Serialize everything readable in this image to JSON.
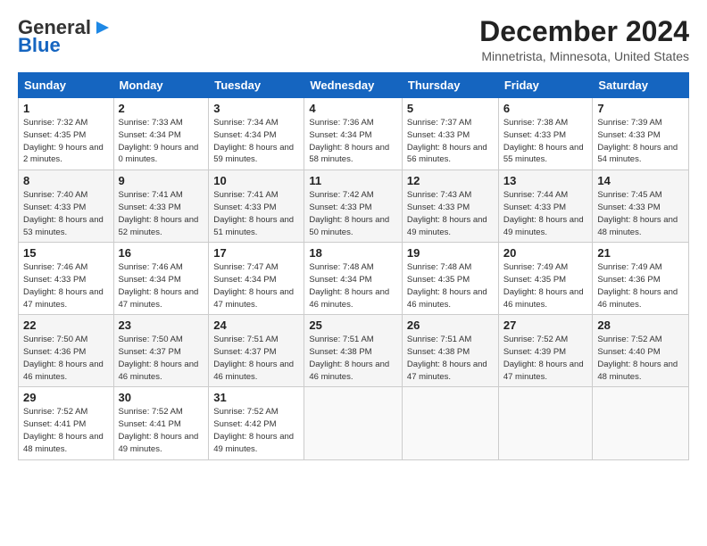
{
  "header": {
    "logo_line1": "General",
    "logo_line2": "Blue",
    "title": "December 2024",
    "subtitle": "Minnetrista, Minnesota, United States"
  },
  "days_of_week": [
    "Sunday",
    "Monday",
    "Tuesday",
    "Wednesday",
    "Thursday",
    "Friday",
    "Saturday"
  ],
  "weeks": [
    [
      {
        "day": "1",
        "sunrise": "Sunrise: 7:32 AM",
        "sunset": "Sunset: 4:35 PM",
        "daylight": "Daylight: 9 hours and 2 minutes."
      },
      {
        "day": "2",
        "sunrise": "Sunrise: 7:33 AM",
        "sunset": "Sunset: 4:34 PM",
        "daylight": "Daylight: 9 hours and 0 minutes."
      },
      {
        "day": "3",
        "sunrise": "Sunrise: 7:34 AM",
        "sunset": "Sunset: 4:34 PM",
        "daylight": "Daylight: 8 hours and 59 minutes."
      },
      {
        "day": "4",
        "sunrise": "Sunrise: 7:36 AM",
        "sunset": "Sunset: 4:34 PM",
        "daylight": "Daylight: 8 hours and 58 minutes."
      },
      {
        "day": "5",
        "sunrise": "Sunrise: 7:37 AM",
        "sunset": "Sunset: 4:33 PM",
        "daylight": "Daylight: 8 hours and 56 minutes."
      },
      {
        "day": "6",
        "sunrise": "Sunrise: 7:38 AM",
        "sunset": "Sunset: 4:33 PM",
        "daylight": "Daylight: 8 hours and 55 minutes."
      },
      {
        "day": "7",
        "sunrise": "Sunrise: 7:39 AM",
        "sunset": "Sunset: 4:33 PM",
        "daylight": "Daylight: 8 hours and 54 minutes."
      }
    ],
    [
      {
        "day": "8",
        "sunrise": "Sunrise: 7:40 AM",
        "sunset": "Sunset: 4:33 PM",
        "daylight": "Daylight: 8 hours and 53 minutes."
      },
      {
        "day": "9",
        "sunrise": "Sunrise: 7:41 AM",
        "sunset": "Sunset: 4:33 PM",
        "daylight": "Daylight: 8 hours and 52 minutes."
      },
      {
        "day": "10",
        "sunrise": "Sunrise: 7:41 AM",
        "sunset": "Sunset: 4:33 PM",
        "daylight": "Daylight: 8 hours and 51 minutes."
      },
      {
        "day": "11",
        "sunrise": "Sunrise: 7:42 AM",
        "sunset": "Sunset: 4:33 PM",
        "daylight": "Daylight: 8 hours and 50 minutes."
      },
      {
        "day": "12",
        "sunrise": "Sunrise: 7:43 AM",
        "sunset": "Sunset: 4:33 PM",
        "daylight": "Daylight: 8 hours and 49 minutes."
      },
      {
        "day": "13",
        "sunrise": "Sunrise: 7:44 AM",
        "sunset": "Sunset: 4:33 PM",
        "daylight": "Daylight: 8 hours and 49 minutes."
      },
      {
        "day": "14",
        "sunrise": "Sunrise: 7:45 AM",
        "sunset": "Sunset: 4:33 PM",
        "daylight": "Daylight: 8 hours and 48 minutes."
      }
    ],
    [
      {
        "day": "15",
        "sunrise": "Sunrise: 7:46 AM",
        "sunset": "Sunset: 4:33 PM",
        "daylight": "Daylight: 8 hours and 47 minutes."
      },
      {
        "day": "16",
        "sunrise": "Sunrise: 7:46 AM",
        "sunset": "Sunset: 4:34 PM",
        "daylight": "Daylight: 8 hours and 47 minutes."
      },
      {
        "day": "17",
        "sunrise": "Sunrise: 7:47 AM",
        "sunset": "Sunset: 4:34 PM",
        "daylight": "Daylight: 8 hours and 47 minutes."
      },
      {
        "day": "18",
        "sunrise": "Sunrise: 7:48 AM",
        "sunset": "Sunset: 4:34 PM",
        "daylight": "Daylight: 8 hours and 46 minutes."
      },
      {
        "day": "19",
        "sunrise": "Sunrise: 7:48 AM",
        "sunset": "Sunset: 4:35 PM",
        "daylight": "Daylight: 8 hours and 46 minutes."
      },
      {
        "day": "20",
        "sunrise": "Sunrise: 7:49 AM",
        "sunset": "Sunset: 4:35 PM",
        "daylight": "Daylight: 8 hours and 46 minutes."
      },
      {
        "day": "21",
        "sunrise": "Sunrise: 7:49 AM",
        "sunset": "Sunset: 4:36 PM",
        "daylight": "Daylight: 8 hours and 46 minutes."
      }
    ],
    [
      {
        "day": "22",
        "sunrise": "Sunrise: 7:50 AM",
        "sunset": "Sunset: 4:36 PM",
        "daylight": "Daylight: 8 hours and 46 minutes."
      },
      {
        "day": "23",
        "sunrise": "Sunrise: 7:50 AM",
        "sunset": "Sunset: 4:37 PM",
        "daylight": "Daylight: 8 hours and 46 minutes."
      },
      {
        "day": "24",
        "sunrise": "Sunrise: 7:51 AM",
        "sunset": "Sunset: 4:37 PM",
        "daylight": "Daylight: 8 hours and 46 minutes."
      },
      {
        "day": "25",
        "sunrise": "Sunrise: 7:51 AM",
        "sunset": "Sunset: 4:38 PM",
        "daylight": "Daylight: 8 hours and 46 minutes."
      },
      {
        "day": "26",
        "sunrise": "Sunrise: 7:51 AM",
        "sunset": "Sunset: 4:38 PM",
        "daylight": "Daylight: 8 hours and 47 minutes."
      },
      {
        "day": "27",
        "sunrise": "Sunrise: 7:52 AM",
        "sunset": "Sunset: 4:39 PM",
        "daylight": "Daylight: 8 hours and 47 minutes."
      },
      {
        "day": "28",
        "sunrise": "Sunrise: 7:52 AM",
        "sunset": "Sunset: 4:40 PM",
        "daylight": "Daylight: 8 hours and 48 minutes."
      }
    ],
    [
      {
        "day": "29",
        "sunrise": "Sunrise: 7:52 AM",
        "sunset": "Sunset: 4:41 PM",
        "daylight": "Daylight: 8 hours and 48 minutes."
      },
      {
        "day": "30",
        "sunrise": "Sunrise: 7:52 AM",
        "sunset": "Sunset: 4:41 PM",
        "daylight": "Daylight: 8 hours and 49 minutes."
      },
      {
        "day": "31",
        "sunrise": "Sunrise: 7:52 AM",
        "sunset": "Sunset: 4:42 PM",
        "daylight": "Daylight: 8 hours and 49 minutes."
      },
      null,
      null,
      null,
      null
    ]
  ]
}
